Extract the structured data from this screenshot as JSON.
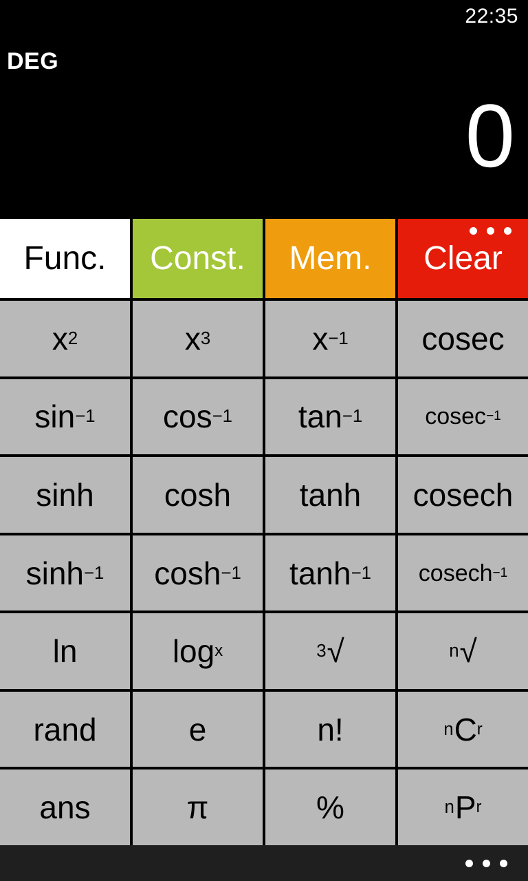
{
  "status_bar": {
    "clock": "22:35"
  },
  "display": {
    "mode": "DEG",
    "value": "0",
    "overflow_icon": "ellipsis-icon"
  },
  "tabs": [
    {
      "label": "Func.",
      "color": "#ffffff",
      "text_color": "#000000",
      "active": true
    },
    {
      "label": "Const.",
      "color": "#a4c639",
      "text_color": "#ffffff",
      "active": false
    },
    {
      "label": "Mem.",
      "color": "#ef9c0e",
      "text_color": "#ffffff",
      "active": false
    },
    {
      "label": "Clear",
      "color": "#e61c0a",
      "text_color": "#ffffff",
      "active": false
    }
  ],
  "keypad": {
    "button_color": "#b9b9b9",
    "button_text_color": "#000000",
    "rows": [
      [
        {
          "name": "square",
          "html": "x<sup>2</sup>"
        },
        {
          "name": "cube",
          "html": "x<sup>3</sup>"
        },
        {
          "name": "reciprocal",
          "html": "x<sup>−1</sup>"
        },
        {
          "name": "cosec",
          "html": "cosec"
        }
      ],
      [
        {
          "name": "arcsin",
          "html": "sin<sup>−1</sup>"
        },
        {
          "name": "arccos",
          "html": "cos<sup>−1</sup>"
        },
        {
          "name": "arctan",
          "html": "tan<sup>−1</sup>"
        },
        {
          "name": "arccosec",
          "html": "cosec<sup>−1</sup>",
          "small": true
        }
      ],
      [
        {
          "name": "sinh",
          "html": "sinh"
        },
        {
          "name": "cosh",
          "html": "cosh"
        },
        {
          "name": "tanh",
          "html": "tanh"
        },
        {
          "name": "cosech",
          "html": "cosech"
        }
      ],
      [
        {
          "name": "arsinh",
          "html": "sinh<sup>−1</sup>"
        },
        {
          "name": "arcosh",
          "html": "cosh<sup>−1</sup>"
        },
        {
          "name": "artanh",
          "html": "tanh<sup>−1</sup>"
        },
        {
          "name": "arcosech",
          "html": "cosech<sup>−1</sup>",
          "small": true
        }
      ],
      [
        {
          "name": "natural-log",
          "html": "ln"
        },
        {
          "name": "log-base-x",
          "html": "log<sub>x</sub>"
        },
        {
          "name": "cube-root",
          "html": "<span class=\"pre-sup\">3</span><span class=\"radical\">√</span>"
        },
        {
          "name": "nth-root",
          "html": "<span class=\"pre-sup\">n</span><span class=\"radical\">√</span>"
        }
      ],
      [
        {
          "name": "random",
          "html": "rand"
        },
        {
          "name": "euler-e",
          "html": "e"
        },
        {
          "name": "factorial",
          "html": "n!"
        },
        {
          "name": "combinations",
          "html": "<span class=\"pre-sup\">n</span>C<sub>r</sub>"
        }
      ],
      [
        {
          "name": "answer",
          "html": "ans"
        },
        {
          "name": "pi",
          "html": "π"
        },
        {
          "name": "percent",
          "html": "%"
        },
        {
          "name": "permutations",
          "html": "<span class=\"pre-sup\">n</span>P<sub>r</sub>"
        }
      ]
    ]
  },
  "app_bar": {
    "more_icon": "ellipsis-icon"
  }
}
